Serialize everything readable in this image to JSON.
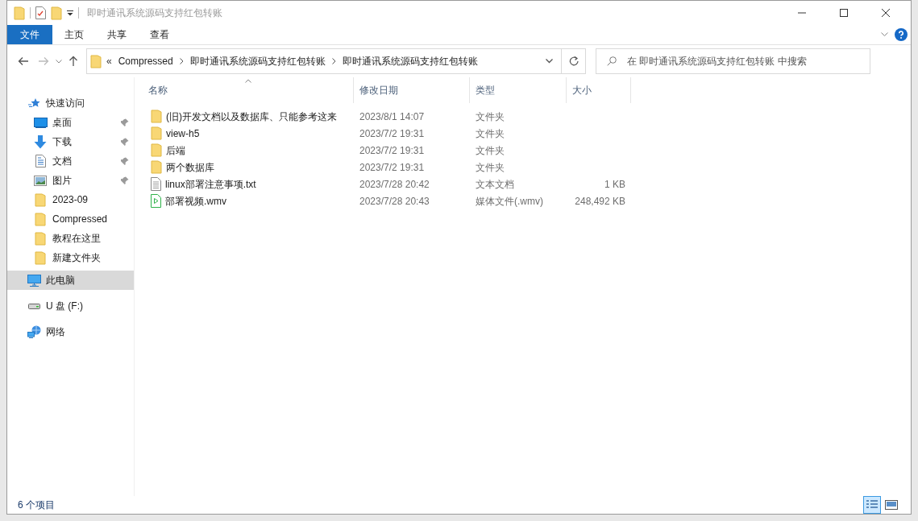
{
  "window": {
    "title": "即时通讯系统源码支持红包转账"
  },
  "ribbon": {
    "tabs": [
      {
        "label": "文件",
        "selected": true
      },
      {
        "label": "主页",
        "selected": false
      },
      {
        "label": "共享",
        "selected": false
      },
      {
        "label": "查看",
        "selected": false
      }
    ]
  },
  "address_bar": {
    "overflow": "«",
    "crumbs": [
      "Compressed",
      "即时通讯系统源码支持红包转账",
      "即时通讯系统源码支持红包转账"
    ]
  },
  "search": {
    "placeholder": "在 即时通讯系统源码支持红包转账 中搜索"
  },
  "sidebar": {
    "items": [
      {
        "label": "快速访问",
        "kind": "quick",
        "pinned": false,
        "selected": false
      },
      {
        "label": "桌面",
        "kind": "desktop",
        "pinned": true,
        "selected": false
      },
      {
        "label": "下载",
        "kind": "download",
        "pinned": true,
        "selected": false
      },
      {
        "label": "文档",
        "kind": "document",
        "pinned": true,
        "selected": false
      },
      {
        "label": "图片",
        "kind": "picture",
        "pinned": true,
        "selected": false
      },
      {
        "label": "2023-09",
        "kind": "folder",
        "pinned": false,
        "selected": false
      },
      {
        "label": "Compressed",
        "kind": "folder",
        "pinned": false,
        "selected": false
      },
      {
        "label": "教程在这里",
        "kind": "folder",
        "pinned": false,
        "selected": false
      },
      {
        "label": "新建文件夹",
        "kind": "folder",
        "pinned": false,
        "selected": false
      },
      {
        "label": "此电脑",
        "kind": "pc",
        "pinned": false,
        "selected": true
      },
      {
        "label": "U 盘 (F:)",
        "kind": "drive",
        "pinned": false,
        "selected": false
      },
      {
        "label": "网络",
        "kind": "network",
        "pinned": false,
        "selected": false
      }
    ]
  },
  "table": {
    "columns": [
      {
        "label": "名称",
        "sorted": true
      },
      {
        "label": "修改日期",
        "sorted": false
      },
      {
        "label": "类型",
        "sorted": false
      },
      {
        "label": "大小",
        "sorted": false
      }
    ],
    "rows": [
      {
        "kind": "folder",
        "name": "(旧)开发文档以及数据库、只能参考这来",
        "date": "2023/8/1 14:07",
        "type": "文件夹",
        "size": ""
      },
      {
        "kind": "folder",
        "name": "view-h5",
        "date": "2023/7/2 19:31",
        "type": "文件夹",
        "size": ""
      },
      {
        "kind": "folder",
        "name": "后端",
        "date": "2023/7/2 19:31",
        "type": "文件夹",
        "size": ""
      },
      {
        "kind": "folder",
        "name": "两个数据库",
        "date": "2023/7/2 19:31",
        "type": "文件夹",
        "size": ""
      },
      {
        "kind": "text",
        "name": "linux部署注意事项.txt",
        "date": "2023/7/28 20:42",
        "type": "文本文档",
        "size": "1 KB"
      },
      {
        "kind": "video",
        "name": "部署视频.wmv",
        "date": "2023/7/28 20:43",
        "type": "媒体文件(.wmv)",
        "size": "248,492 KB"
      }
    ]
  },
  "status_bar": {
    "item_count": "6 个项目",
    "views": [
      {
        "kind": "details",
        "selected": true
      },
      {
        "kind": "thumbnails",
        "selected": false
      }
    ]
  }
}
